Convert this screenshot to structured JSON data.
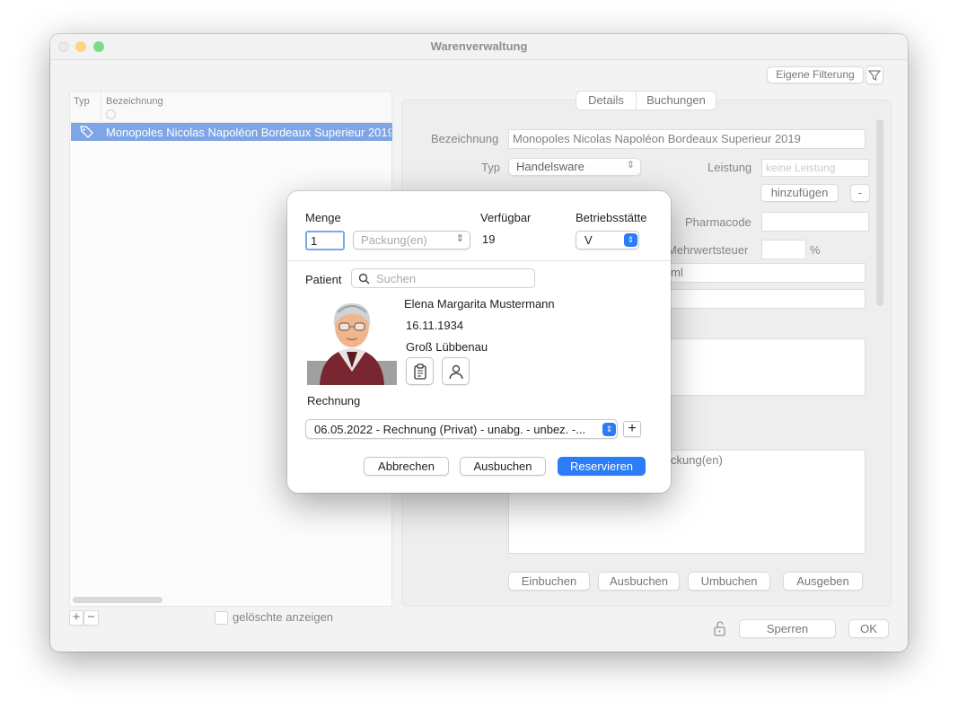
{
  "window": {
    "title": "Warenverwaltung"
  },
  "toolbar": {
    "filter_button": "Eigene Filterung"
  },
  "list": {
    "columns": {
      "typ": "Typ",
      "bezeichnung": "Bezeichnung"
    },
    "rows": [
      {
        "name": "Monopoles Nicolas Napoléon Bordeaux Superieur 2019"
      }
    ],
    "show_deleted": "gelöschte anzeigen"
  },
  "tabs": {
    "details": "Details",
    "buchungen": "Buchungen"
  },
  "details": {
    "bezeichnung_label": "Bezeichnung",
    "bezeichnung_value": "Monopoles Nicolas Napoléon Bordeaux Superieur 2019",
    "typ_label": "Typ",
    "typ_value": "Handelsware",
    "leistung_label": "Leistung",
    "leistung_placeholder": "keine Leistung",
    "hinzufuegen": "hinzufügen",
    "minus": "-",
    "pharmacode_label": "Pharmacode",
    "mwst_label": "Mehrwertsteuer",
    "percent": "%",
    "ml": "ml",
    "packungen_text": "ckung(en)"
  },
  "bottom_buttons": {
    "einbuchen": "Einbuchen",
    "ausbuchen": "Ausbuchen",
    "umbuchen": "Umbuchen",
    "ausgeben": "Ausgeben"
  },
  "footer": {
    "sperren": "Sperren",
    "ok": "OK"
  },
  "dialog": {
    "menge_label": "Menge",
    "menge_value": "1",
    "unit_placeholder": "Packung(en)",
    "verfuegbar_label": "Verfügbar",
    "verfuegbar_value": "19",
    "betriebsstaette_label": "Betriebsstätte",
    "betriebsstaette_value": "V",
    "patient_label": "Patient",
    "search_placeholder": "Suchen",
    "patient": {
      "name": "Elena Margarita Mustermann",
      "birthdate": "16.11.1934",
      "city": "Groß Lübbenau"
    },
    "rechnung_label": "Rechnung",
    "rechnung_value": "06.05.2022 - Rechnung (Privat) - unabg. - unbez. -...",
    "add": "+",
    "abbrechen": "Abbrechen",
    "ausbuchen": "Ausbuchen",
    "reservieren": "Reservieren"
  },
  "colors": {
    "accent": "#2b7cf6",
    "selection": "#2f6fd6"
  }
}
